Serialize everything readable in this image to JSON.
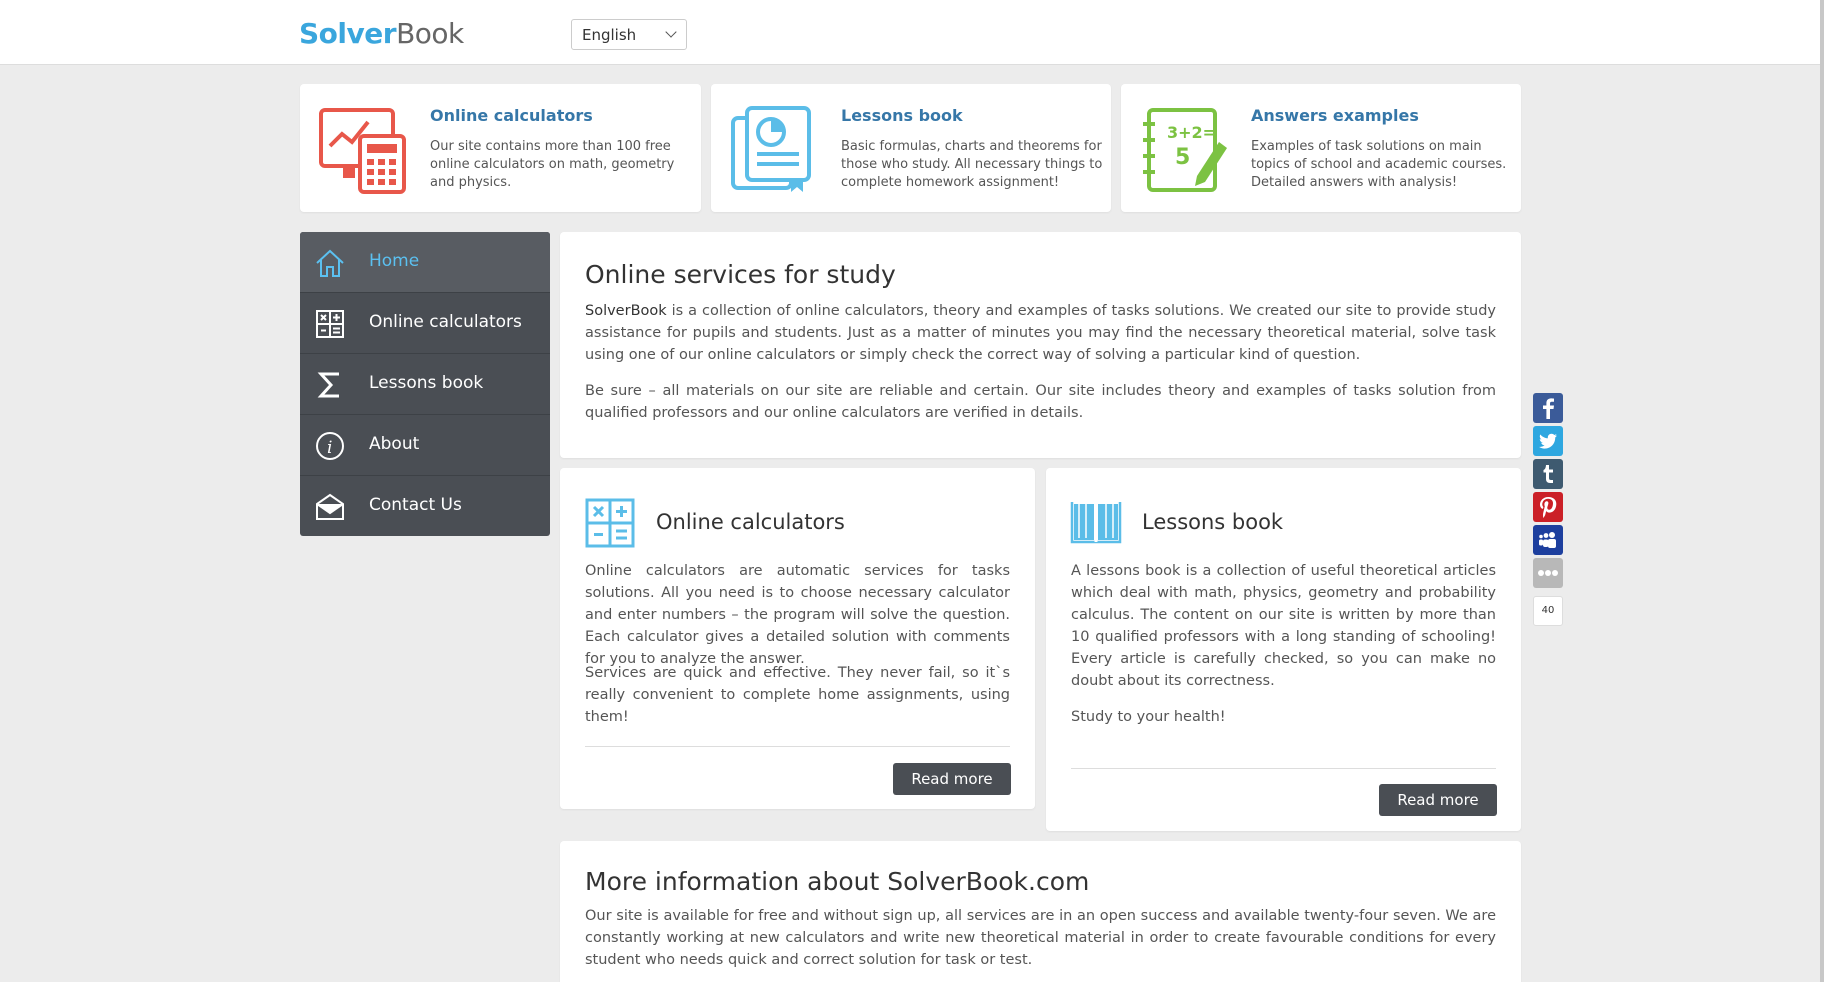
{
  "header": {
    "logo_part1": "Solver",
    "logo_part2": "Book",
    "language": "English"
  },
  "features": [
    {
      "title": "Online calculators",
      "text": "Our site contains more than 100 free online calculators on math, geometry and physics.",
      "icon": "calculator-monitor-icon"
    },
    {
      "title": "Lessons book",
      "text": "Basic formulas, charts and theorems for those who study. All necessary things to complete homework assignment!",
      "icon": "lessons-book-icon"
    },
    {
      "title": "Answers examples",
      "text": "Examples of task solutions on main topics of school and academic courses. Detailed answers with analysis!",
      "icon": "answers-notebook-icon"
    }
  ],
  "sidebar": {
    "items": [
      {
        "label": "Home",
        "icon": "home-icon",
        "active": true
      },
      {
        "label": "Online calculators",
        "icon": "calculator-icon"
      },
      {
        "label": "Lessons book",
        "icon": "sigma-icon"
      },
      {
        "label": "About",
        "icon": "info-icon"
      },
      {
        "label": "Contact Us",
        "icon": "envelope-icon"
      }
    ]
  },
  "intro": {
    "title": "Online services for study",
    "brand": "SolverBook",
    "p1_rest": " is a collection of online calculators, theory and examples of tasks solutions. We created our site to provide study assistance for pupils and students. Just as a matter of minutes you may find the necessary theoretical material, solve task using one of our online calculators or simply check the correct way of solving a particular kind of question.",
    "p2": "Be sure – all materials on our site are reliable and certain. Our site includes theory and examples of tasks solution from qualified professors and our online calculators are verified in details."
  },
  "calculators_card": {
    "title": "Online calculators",
    "p1": "Online calculators are automatic services for tasks solutions. All you need is to choose necessary calculator and enter numbers – the program will solve the question. Each calculator gives a detailed solution with comments for you to analyze the answer.",
    "p2": "Services are quick and effective. They never fail, so it`s really convenient to complete home assignments, using them!",
    "button": "Read more"
  },
  "lessons_card": {
    "title": "Lessons book",
    "p1": "A lessons book is a collection of useful theoretical articles which deal with math, physics, geometry and probability calculus. The content on our site is written by more than 10 qualified professors with a long standing of schooling! Every article is carefully checked, so you can make no doubt about its correctness.",
    "p2": "Study to your health!",
    "button": "Read more"
  },
  "more_info": {
    "title": "More information about SolverBook.com",
    "p1": "Our site is available for free and without sign up, all services are in an open success and available twenty-four seven. We are constantly working at new calculators and write new theoretical material in order to create favourable conditions for every student who needs quick and correct solution for task or test."
  },
  "social": {
    "buttons": [
      "facebook-icon",
      "twitter-icon",
      "tumblr-icon",
      "pinterest-icon",
      "myspace-icon",
      "more-icon"
    ],
    "share_count": "40"
  },
  "colors": {
    "accent_blue": "#3aa6dd",
    "sidebar_bg": "#4a4e54",
    "feature_red": "#e8574a",
    "feature_blue": "#5bbde8",
    "feature_green": "#7cc242"
  }
}
